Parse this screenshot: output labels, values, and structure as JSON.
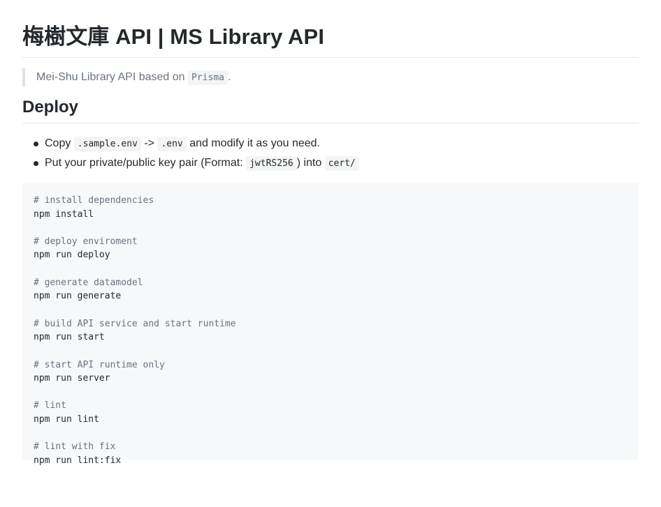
{
  "title": "梅樹文庫 API | MS Library API",
  "quote": {
    "text_before": "Mei-Shu Library API based on ",
    "code": "Prisma",
    "text_after": "."
  },
  "deploy": {
    "heading": "Deploy",
    "steps": [
      {
        "t1": "Copy ",
        "c1": ".sample.env",
        "t2": " -> ",
        "c2": ".env",
        "t3": " and modify it as you need."
      },
      {
        "t1": "Put your private/public key pair (Format: ",
        "c1": "jwtRS256",
        "t2": ") into ",
        "c2": "cert/"
      }
    ]
  },
  "code_block": [
    {
      "comment": "# install dependencies",
      "command": "npm install"
    },
    {
      "comment": "# deploy enviroment",
      "command": "npm run deploy"
    },
    {
      "comment": "# generate datamodel",
      "command": "npm run generate"
    },
    {
      "comment": "# build API service and start runtime",
      "command": "npm run start"
    },
    {
      "comment": "# start API runtime only",
      "command": "npm run server"
    },
    {
      "comment": "# lint",
      "command": "npm run lint"
    },
    {
      "comment": "# lint with fix",
      "command": "npm run lint:fix"
    }
  ]
}
